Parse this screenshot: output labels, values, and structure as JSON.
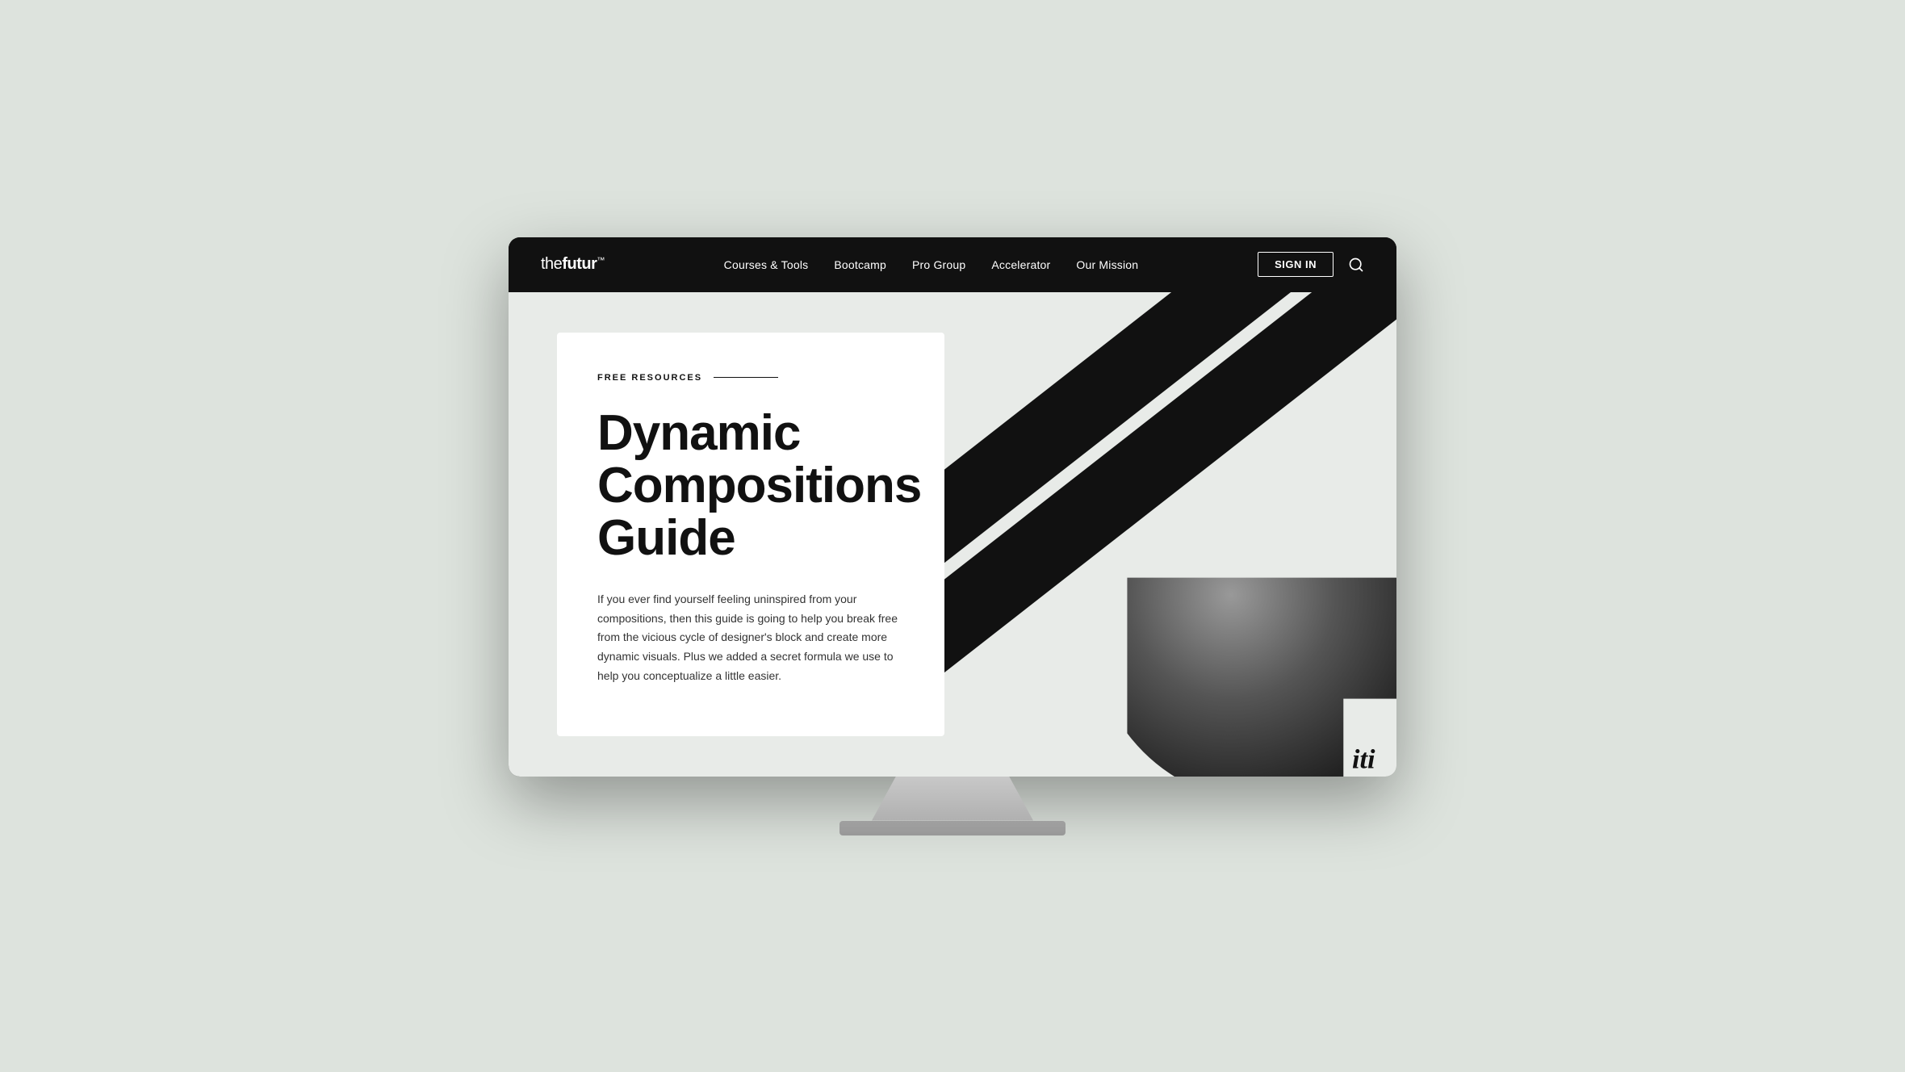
{
  "screen": {
    "brand": {
      "name": "thefutur",
      "trademark": "™"
    },
    "nav": {
      "links": [
        {
          "label": "Courses & Tools",
          "id": "courses-tools"
        },
        {
          "label": "Bootcamp",
          "id": "bootcamp"
        },
        {
          "label": "Pro Group",
          "id": "pro-group"
        },
        {
          "label": "Accelerator",
          "id": "accelerator"
        },
        {
          "label": "Our Mission",
          "id": "our-mission"
        }
      ],
      "sign_in": "SIGN IN"
    },
    "hero": {
      "badge": "FREE RESOURCES",
      "title": "Dynamic Compositions Guide",
      "description": "If you ever find yourself feeling uninspired from your compositions, then this guide is going to help you break free from the vicious cycle of designer's block and create more dynamic visuals. Plus we added a secret formula we use to help you conceptualize a little easier."
    }
  }
}
